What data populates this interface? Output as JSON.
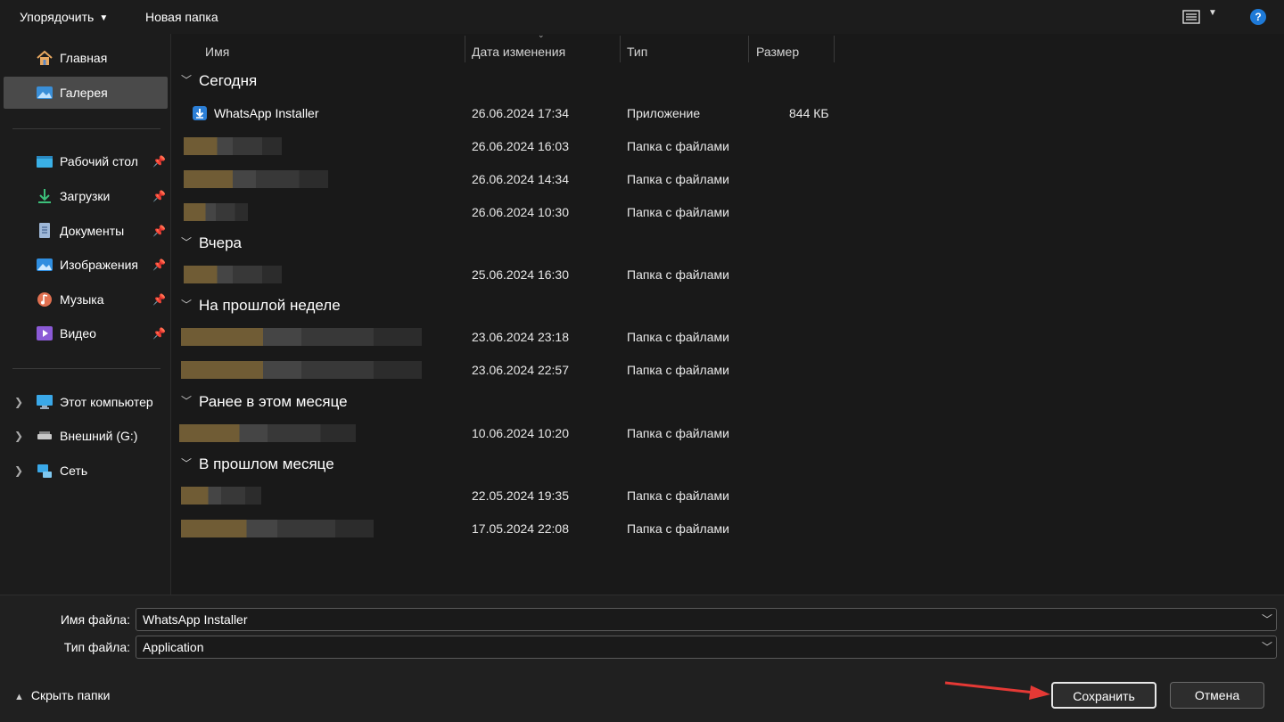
{
  "toolbar": {
    "organize_label": "Упорядочить",
    "new_folder_label": "Новая папка",
    "help_label": "?"
  },
  "sidebar": {
    "top_items": [
      {
        "label": "Главная",
        "icon": "home-icon"
      },
      {
        "label": "Галерея",
        "icon": "gallery-icon",
        "selected": true
      }
    ],
    "pinned_items": [
      {
        "label": "Рабочий стол",
        "icon": "desktop-icon"
      },
      {
        "label": "Загрузки",
        "icon": "downloads-icon"
      },
      {
        "label": "Документы",
        "icon": "documents-icon"
      },
      {
        "label": "Изображения",
        "icon": "pictures-icon"
      },
      {
        "label": "Музыка",
        "icon": "music-icon"
      },
      {
        "label": "Видео",
        "icon": "video-icon"
      }
    ],
    "tree_items": [
      {
        "label": "Этот компьютер",
        "icon": "computer-icon"
      },
      {
        "label": "Внешний (G:)",
        "icon": "drive-icon"
      },
      {
        "label": "Сеть",
        "icon": "network-icon"
      }
    ]
  },
  "columns": {
    "name": "Имя",
    "date": "Дата изменения",
    "type": "Тип",
    "size": "Размер"
  },
  "groups": [
    {
      "title": "Сегодня",
      "rows": [
        {
          "name": "WhatsApp Installer",
          "date": "26.06.2024 17:34",
          "type": "Приложение",
          "size": "844 КБ"
        },
        {
          "name": "",
          "date": "26.06.2024 16:03",
          "type": "Папка с файлами",
          "size": ""
        },
        {
          "name": "",
          "date": "26.06.2024 14:34",
          "type": "Папка с файлами",
          "size": ""
        },
        {
          "name": "",
          "date": "26.06.2024 10:30",
          "type": "Папка с файлами",
          "size": ""
        }
      ]
    },
    {
      "title": "Вчера",
      "rows": [
        {
          "name": "",
          "date": "25.06.2024 16:30",
          "type": "Папка с файлами",
          "size": ""
        }
      ]
    },
    {
      "title": "На прошлой неделе",
      "rows": [
        {
          "name": "",
          "date": "23.06.2024 23:18",
          "type": "Папка с файлами",
          "size": ""
        },
        {
          "name": "",
          "date": "23.06.2024 22:57",
          "type": "Папка с файлами",
          "size": ""
        }
      ]
    },
    {
      "title": "Ранее в этом месяце",
      "rows": [
        {
          "name": "",
          "date": "10.06.2024 10:20",
          "type": "Папка с файлами",
          "size": ""
        }
      ]
    },
    {
      "title": "В прошлом месяце",
      "rows": [
        {
          "name": "",
          "date": "22.05.2024 19:35",
          "type": "Папка с файлами",
          "size": ""
        },
        {
          "name": "",
          "date": "17.05.2024 22:08",
          "type": "Папка с файлами",
          "size": ""
        }
      ]
    }
  ],
  "bottom": {
    "filename_label": "Имя файла:",
    "filename_value": "WhatsApp Installer",
    "filetype_label": "Тип файла:",
    "filetype_value": "Application",
    "hide_folders_label": "Скрыть папки",
    "save_label": "Сохранить",
    "cancel_label": "Отмена"
  },
  "colors": {
    "accent": "#1e7ad8",
    "annotation_arrow": "#e53935"
  }
}
